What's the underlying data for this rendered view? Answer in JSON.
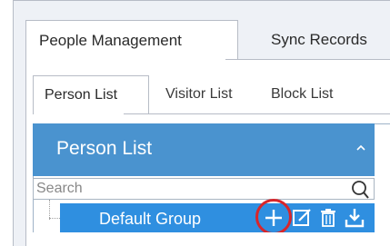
{
  "top_tabs": {
    "people_management": "People Management",
    "sync_records": "Sync Records"
  },
  "sub_tabs": {
    "person_list": "Person List",
    "visitor_list": "Visitor List",
    "block_list": "Block List"
  },
  "tree_panel": {
    "title": "Person List",
    "search_placeholder": "Search",
    "groups": [
      {
        "label": "Default Group"
      }
    ],
    "row_actions": [
      "add-icon",
      "edit-icon",
      "delete-icon",
      "export-icon"
    ]
  },
  "colors": {
    "header_blue": "#4a93cf",
    "selected_row_blue": "#2f8fe0",
    "highlight_red": "#d8262b",
    "panel_bg": "#eef1f6"
  }
}
